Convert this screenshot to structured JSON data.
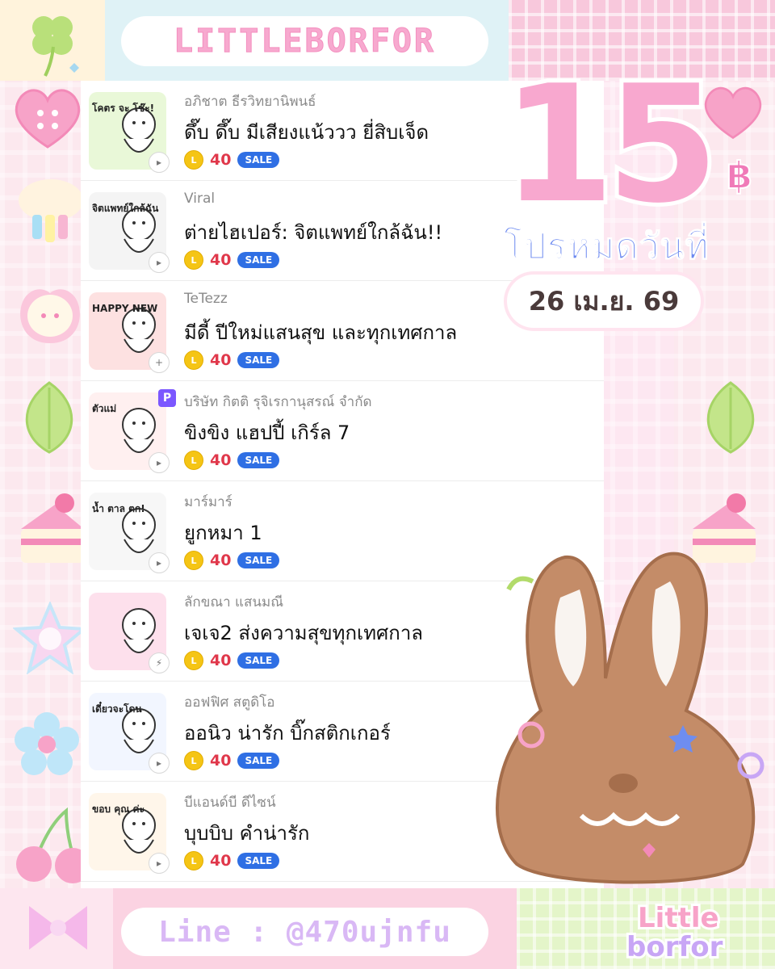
{
  "header": {
    "brand": "LITTLEBORFOR"
  },
  "promo": {
    "number": "15",
    "currency": "฿",
    "text": "โปรหมดวันที่",
    "date": "26 เม.ย. 69"
  },
  "stickers": [
    {
      "author": "อภิชาต ธีรวิทยานิพนธ์",
      "title": "ดึ๊บ ดึ๊บ มีเสียงแน้ววว ยี่สิบเจ็ด",
      "coin": "L",
      "price": "40",
      "badge": "SALE",
      "thumb_text": "โคตร จะ โช๊ะ!",
      "icon": "sound-icon"
    },
    {
      "author": "Viral",
      "title": "ต่ายไฮเปอร์: จิตแพทย์ใกล้ฉัน!!",
      "coin": "L",
      "price": "40",
      "badge": "SALE",
      "thumb_text": "จิตแพทย์ใกล้ฉัน",
      "icon": "sound-icon"
    },
    {
      "author": "TeTezz",
      "title": "มีดี้ ปีใหม่แสนสุข และทุกเทศกาล",
      "coin": "L",
      "price": "40",
      "badge": "SALE",
      "thumb_text": "HAPPY NEW",
      "icon": "plus-icon"
    },
    {
      "author": "บริษัท กิตติ รุจิเรกานุสรณ์ จำกัด",
      "title": "ขิงขิง แฮปปี้ เกิร์ล 7",
      "coin": "L",
      "price": "40",
      "badge": "SALE",
      "thumb_text": "ตัวแม่",
      "premium": "P",
      "icon": "sound-icon"
    },
    {
      "author": "มาร์มาร์",
      "title": "ยูกหมา 1",
      "coin": "L",
      "price": "40",
      "badge": "SALE",
      "thumb_text": "น้ำ ตาล ตก!",
      "icon": "sound-icon"
    },
    {
      "author": "ลักขณา แสนมณี",
      "title": "เจเจ2 ส่งความสุขทุกเทศกาล",
      "coin": "L",
      "price": "40",
      "badge": "SALE",
      "thumb_text": "",
      "icon": "bolt-icon"
    },
    {
      "author": "ออฟฟิศ สตูดิโอ",
      "title": "ออนิว น่ารัก บิ๊กสติกเกอร์",
      "coin": "L",
      "price": "40",
      "badge": "SALE",
      "thumb_text": "เดี๋ยวจะโดน",
      "icon": "sound-icon"
    },
    {
      "author": "บีแอนด์บี ดีไซน์",
      "title": "บุบบิบ คำน่ารัก",
      "coin": "L",
      "price": "40",
      "badge": "SALE",
      "thumb_text": "ขอบ คุณ ค่ะ",
      "icon": "sound-icon"
    }
  ],
  "footer": {
    "line_id": "Line : @470ujnfu",
    "logo_top": "Little",
    "logo_bottom": "borfor"
  },
  "colors": {
    "pink": "#f7a9cf",
    "lavender": "#c9b6f7",
    "sale_blue": "#2f6fe4",
    "price_red": "#e0384b",
    "coin_gold": "#f5c515"
  }
}
